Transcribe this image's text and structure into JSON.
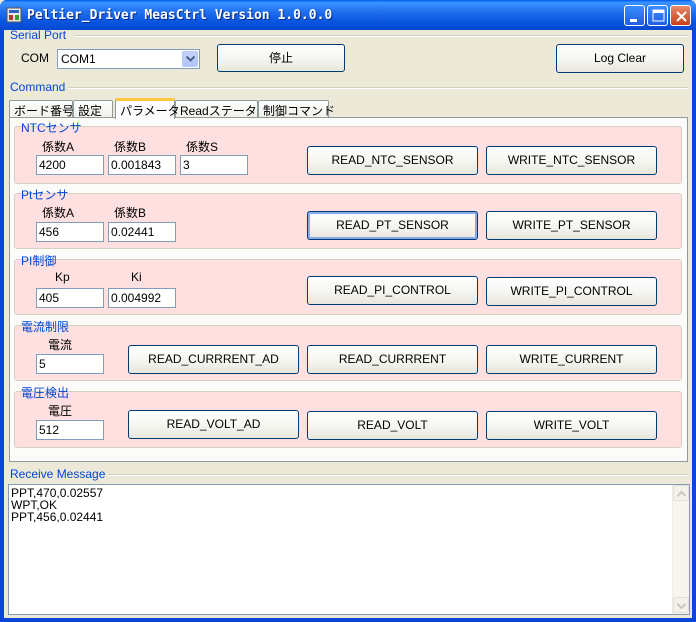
{
  "window": {
    "title": "Peltier_Driver MeasCtrl Version 1.0.0.0"
  },
  "serial_port": {
    "group_title": "Serial Port",
    "com_label": "COM",
    "com_value": "COM1",
    "stop_label": "停止",
    "log_clear_label": "Log Clear"
  },
  "command": {
    "group_title": "Command",
    "tabs": [
      {
        "label": "ボード番号"
      },
      {
        "label": "設定"
      },
      {
        "label": "パラメータ",
        "active": true
      },
      {
        "label": "Readステータス"
      },
      {
        "label": "制御コマンド"
      }
    ]
  },
  "ntc": {
    "title": "NTCセンサ",
    "label_a": "係数A",
    "label_b": "係数B",
    "label_s": "係数S",
    "value_a": "4200",
    "value_b": "0.001843",
    "value_s": "3",
    "read_label": "READ_NTC_SENSOR",
    "write_label": "WRITE_NTC_SENSOR"
  },
  "pt": {
    "title": "Ptセンサ",
    "label_a": "係数A",
    "label_b": "係数B",
    "value_a": "456",
    "value_b": "0.02441",
    "read_label": "READ_PT_SENSOR",
    "write_label": "WRITE_PT_SENSOR"
  },
  "pi": {
    "title": "PI制御",
    "label_kp": "Kp",
    "label_ki": "Ki",
    "value_kp": "405",
    "value_ki": "0.004992",
    "read_label": "READ_PI_CONTROL",
    "write_label": "WRITE_PI_CONTROL"
  },
  "current": {
    "title": "電流制限",
    "label": "電流",
    "value": "5",
    "read_ad_label": "READ_CURRRENT_AD",
    "read_label": "READ_CURRRENT",
    "write_label": "WRITE_CURRENT"
  },
  "voltage": {
    "title": "電圧検出",
    "label": "電圧",
    "value": "512",
    "read_ad_label": "READ_VOLT_AD",
    "read_label": "READ_VOLT",
    "write_label": "WRITE_VOLT"
  },
  "receive": {
    "group_title": "Receive Message",
    "lines": [
      "PPT,470,0.02557",
      "WPT,OK",
      "PPT,456,0.02441"
    ]
  },
  "colors": {
    "group_title": "#0046d5",
    "param_bg": "#ffe0e0",
    "titlebar": "#0a56e0"
  },
  "icons": [
    "app-icon",
    "minimize-icon",
    "maximize-icon",
    "close-icon",
    "chevron-down-icon",
    "scroll-up-icon",
    "scroll-down-icon"
  ]
}
